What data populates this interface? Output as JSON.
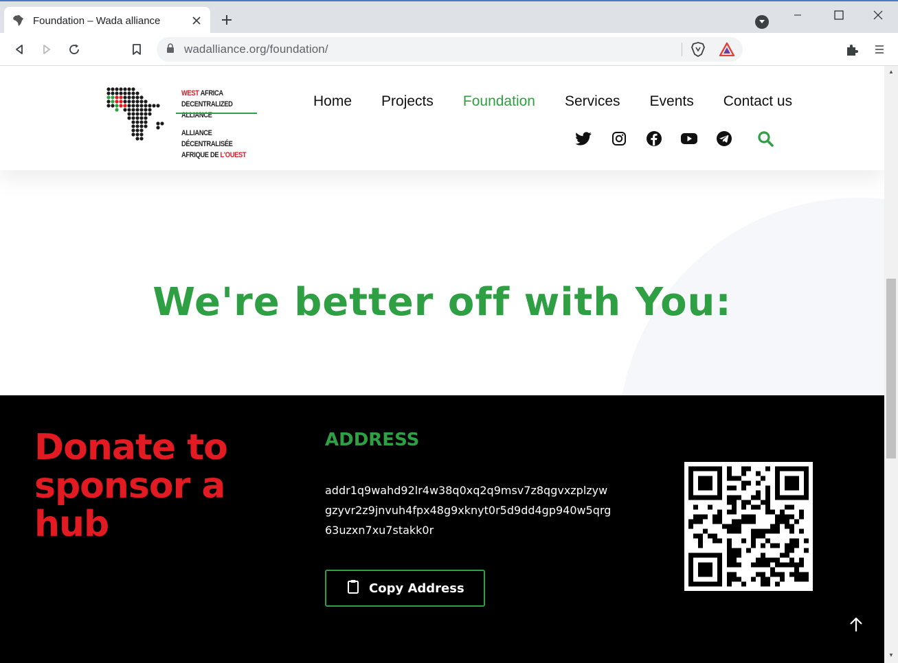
{
  "browser": {
    "tab_title": "Foundation – Wada alliance",
    "tab_close_glyph": "✕",
    "new_tab_glyph": "+",
    "url": "wadalliance.org/foundation/"
  },
  "site": {
    "logo": {
      "line1_red": "WEST",
      "line1_rest": " AFRICA",
      "line2": "DECENTRALIZED ALLIANCE",
      "line3": "ALLIANCE DÉCENTRALISÉE",
      "line4_prefix": "AFRIQUE DE ",
      "line4_red": "L'OUEST"
    },
    "nav": [
      {
        "label": "Home"
      },
      {
        "label": "Projects"
      },
      {
        "label": "Foundation",
        "active": true
      },
      {
        "label": "Services"
      },
      {
        "label": "Events"
      },
      {
        "label": "Contact us"
      }
    ],
    "socials": [
      "twitter-icon",
      "instagram-icon",
      "facebook-icon",
      "youtube-icon",
      "telegram-icon"
    ]
  },
  "hero": {
    "title": "We're better off with You:"
  },
  "donate": {
    "title": "Donate to sponsor a hub",
    "address_label": "ADDRESS",
    "address_value": "addr1q9wahd92lr4w38q0xq2q9msv7z8qgvxzplzywgzyvr2z9jnvuh4fpx48g9xknyt0r5d9dd4gp940w5qrg63uzxn7xu7stakk0r",
    "copy_button": "Copy Address"
  },
  "colors": {
    "brand_green": "#2ea043",
    "brand_red": "#e21a22",
    "dark_bg": "#000000"
  }
}
